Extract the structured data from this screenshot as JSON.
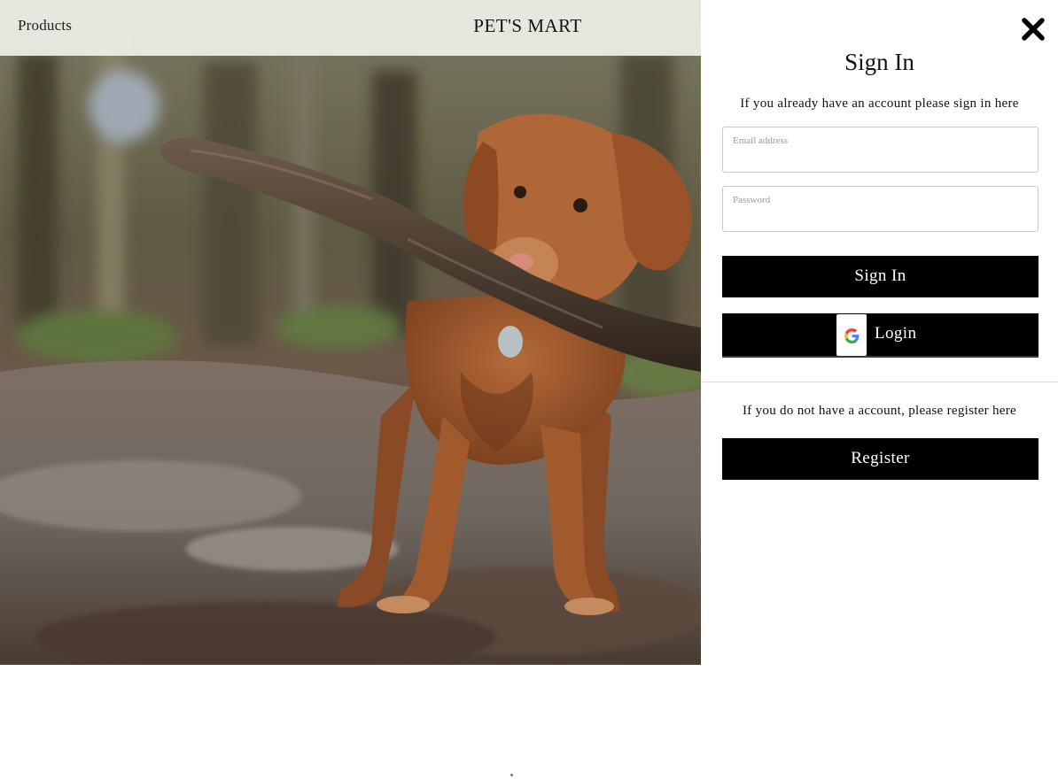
{
  "header": {
    "nav_products": "Products",
    "brand": "PET'S MART"
  },
  "hero": {
    "image_subject": "dog-carrying-stick-photo"
  },
  "signin_panel": {
    "close_icon": "close-icon",
    "title": "Sign In",
    "intro_text": "If you already have an account please sign in here",
    "email_label": "Email address",
    "email_value": "",
    "password_label": "Password",
    "password_value": "",
    "signin_button": "Sign In",
    "google_icon": "google-icon",
    "google_button": "Login",
    "register_text": "If you do not have a account, please register here",
    "register_button": "Register"
  },
  "colors": {
    "button_bg": "#000000",
    "button_text": "#ffffff",
    "nav_bg": "#f0f0ea",
    "panel_bg": "#ffffff"
  }
}
